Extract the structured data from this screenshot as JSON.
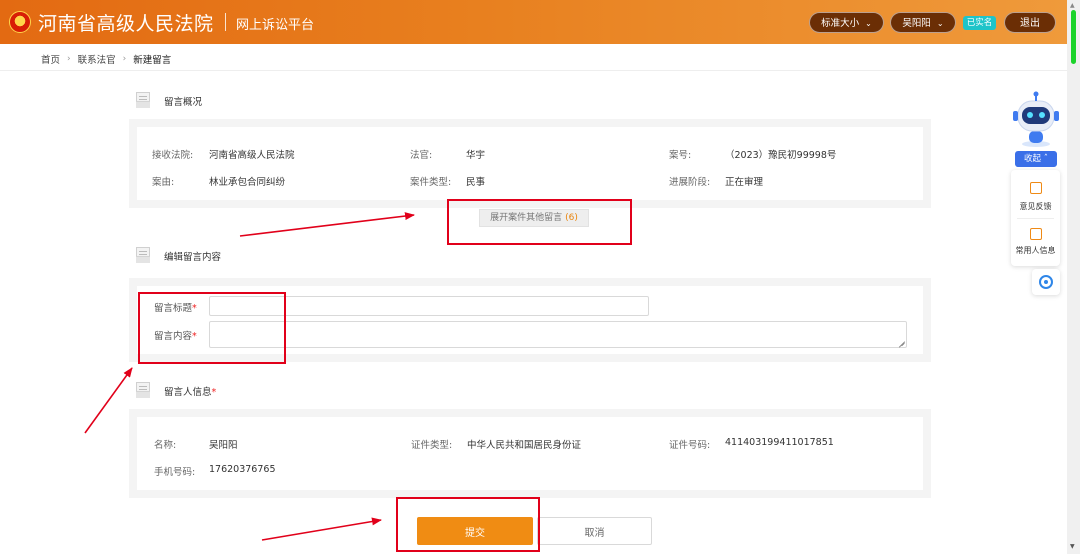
{
  "header": {
    "site_title": "河南省高级人民法院",
    "site_subtitle": "网上诉讼平台",
    "font_size_label": "标准大小",
    "user_name": "吴阳阳",
    "verified_label": "已实名",
    "logout_label": "退出",
    "colors": {
      "bar_start": "#e36a12",
      "bar_end": "#ef9a3b",
      "pill": "#6b2e05",
      "verified": "#1ec4c9"
    }
  },
  "breadcrumb": [
    "首页",
    "联系法官",
    "新建留言"
  ],
  "overview": {
    "section_title": "留言概况",
    "fields": [
      {
        "label": "接收法院:",
        "value": "河南省高级人民法院"
      },
      {
        "label": "法官:",
        "value": "华宇"
      },
      {
        "label": "案号:",
        "value": "（2023）豫民初99998号"
      },
      {
        "label": "案由:",
        "value": "林业承包合同纠纷"
      },
      {
        "label": "案件类型:",
        "value": "民事"
      },
      {
        "label": "进展阶段:",
        "value": "正在审理"
      }
    ],
    "expand_label": "展开案件其他留言",
    "expand_count": "(6)"
  },
  "edit": {
    "section_title": "编辑留言内容",
    "title_label": "留言标题",
    "content_label": "留言内容",
    "required_mark": "*",
    "title_value": "",
    "content_value": ""
  },
  "sender": {
    "section_title": "留言人信息",
    "required_mark": "*",
    "fields": [
      {
        "label": "名称:",
        "value": "吴阳阳"
      },
      {
        "label": "证件类型:",
        "value": "中华人民共和国居民身份证"
      },
      {
        "label": "证件号码:",
        "value": "411403199411017851"
      },
      {
        "label": "手机号码:",
        "value": "17620376765"
      }
    ]
  },
  "actions": {
    "submit_label": "提交",
    "cancel_label": "取消",
    "submit_color": "#f08c13"
  },
  "assistant": {
    "collapse_label": "收起",
    "feedback_label": "意见反馈",
    "contacts_label": "常用人信息"
  },
  "annotation_color": "#e1001a"
}
